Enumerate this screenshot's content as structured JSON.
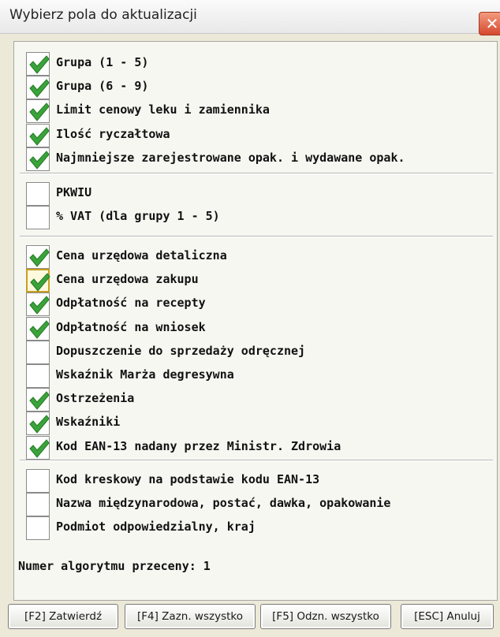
{
  "window": {
    "title": "Wybierz pola do aktualizacji",
    "close_glyph": "✕"
  },
  "groups": [
    {
      "items": [
        {
          "label": "Grupa (1 - 5)",
          "checked": true
        },
        {
          "label": "Grupa (6 - 9)",
          "checked": true
        },
        {
          "label": "Limit cenowy leku i zamiennika",
          "checked": true
        },
        {
          "label": "Ilość ryczałtowa",
          "checked": true
        },
        {
          "label": "Najmniejsze zarejestrowane opak. i wydawane opak.",
          "checked": true
        }
      ]
    },
    {
      "items": [
        {
          "label": "PKWIU",
          "checked": false
        },
        {
          "label": "% VAT (dla grupy 1 - 5)",
          "checked": false
        }
      ]
    },
    {
      "items": [
        {
          "label": "Cena urzędowa detaliczna",
          "checked": true
        },
        {
          "label": "Cena urzędowa zakupu",
          "checked": true,
          "focused": true
        },
        {
          "label": "Odpłatność na recepty",
          "checked": true
        },
        {
          "label": "Odpłatność na wniosek",
          "checked": true
        },
        {
          "label": "Dopuszczenie do sprzedaży odręcznej",
          "checked": false
        },
        {
          "label": "Wskaźnik Marża degresywna",
          "checked": false
        },
        {
          "label": "Ostrzeżenia",
          "checked": true
        },
        {
          "label": "Wskaźniki",
          "checked": true
        },
        {
          "label": "Kod EAN-13 nadany przez Ministr. Zdrowia",
          "checked": true
        }
      ]
    },
    {
      "items": [
        {
          "label": "Kod kreskowy na podstawie kodu EAN-13",
          "checked": false
        },
        {
          "label": "Nazwa międzynarodowa, postać, dawka, opakowanie",
          "checked": false
        },
        {
          "label": "Podmiot odpowiedzialny, kraj",
          "checked": false
        }
      ]
    }
  ],
  "algorithm_text": "Numer algorytmu przeceny: 1",
  "buttons": [
    {
      "label": "[F2] Zatwierdź"
    },
    {
      "label": "[F4] Zazn. wszystko"
    },
    {
      "label": "[F5] Odzn. wszystko"
    },
    {
      "label": "[ESC] Anuluj"
    }
  ],
  "colors": {
    "check": "#3aa33a",
    "check_dark": "#237a23",
    "focus": "#c9a020"
  }
}
